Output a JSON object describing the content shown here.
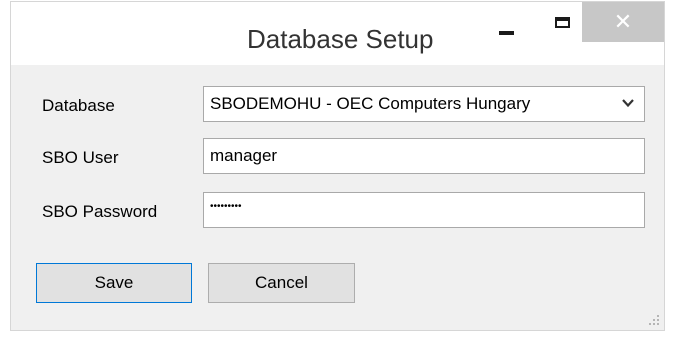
{
  "window": {
    "title": "Database Setup",
    "close_glyph": "✕"
  },
  "form": {
    "database_label": "Database",
    "database_value": "SBODEMOHU - OEC Computers Hungary",
    "user_label": "SBO User",
    "user_value": "manager",
    "password_label": "SBO Password",
    "password_mask": "•••••••••"
  },
  "buttons": {
    "save_label": "Save",
    "cancel_label": "Cancel"
  },
  "icons": {
    "minimize": "minimize-icon",
    "maximize": "maximize-icon",
    "close": "close-icon",
    "dropdown": "chevron-down-icon",
    "resize": "resize-grip-icon"
  },
  "colors": {
    "close_button_bg": "#c7c7c7",
    "focus_border": "#0078d7",
    "dialog_bg": "#f0f0f0"
  }
}
